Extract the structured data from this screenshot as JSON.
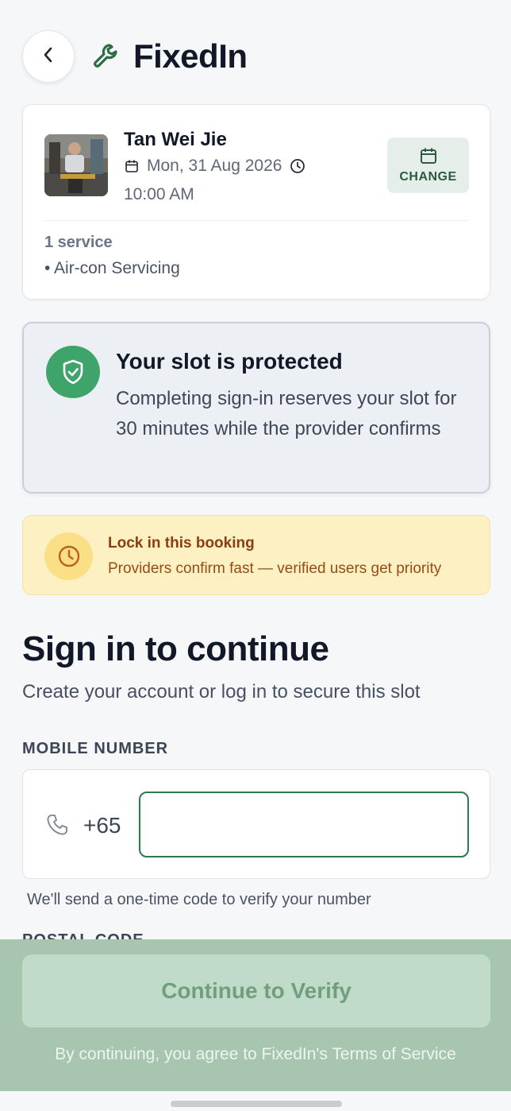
{
  "app": {
    "name": "FixedIn",
    "logo_icon": "wrench-icon"
  },
  "header": {
    "back_icon": "chevron-left-icon"
  },
  "booking": {
    "provider_name": "Tan Wei Jie",
    "date": "Mon, 31 Aug 2026",
    "time": "10:00 AM",
    "change_label": "CHANGE",
    "service_count": "1 service",
    "services": [
      "• Air-con Servicing"
    ]
  },
  "protected": {
    "title": "Your slot is protected",
    "body": "Completing sign-in reserves your slot for 30 minutes while the provider confirms"
  },
  "lock_banner": {
    "title": "Lock in this booking",
    "subtitle": "Providers confirm fast — verified users get priority"
  },
  "signin": {
    "title": "Sign in to continue",
    "subtitle": "Create your account or log in to secure this slot",
    "mobile_label": "MOBILE NUMBER",
    "country_code": "+65",
    "mobile_value": "",
    "otp_note": "We'll send a one-time code to verify your number",
    "postal_label": "POSTAL CODE"
  },
  "footer": {
    "continue_label": "Continue to Verify",
    "terms": "By continuing, you agree to FixedIn's Terms of Service"
  },
  "colors": {
    "brand_green": "#2e7a4c",
    "shield_green": "#3fa46a",
    "banner_yellow": "#fdf1c4",
    "banner_text": "#8a3e12",
    "bottom_bar": "#a6c6b0"
  }
}
